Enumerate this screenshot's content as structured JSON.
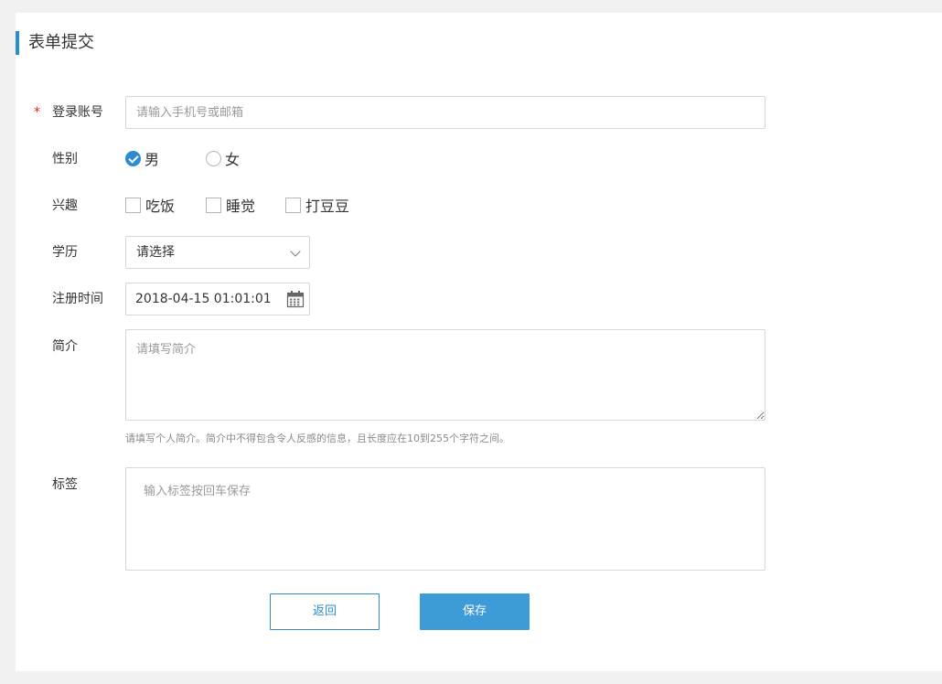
{
  "form": {
    "title": "表单提交",
    "required_mark": "*",
    "account": {
      "label": "登录账号",
      "value": "",
      "placeholder": "请输入手机号或邮箱"
    },
    "gender": {
      "label": "性别",
      "options": [
        {
          "label": "男",
          "checked": true
        },
        {
          "label": "女",
          "checked": false
        }
      ]
    },
    "interests": {
      "label": "兴趣",
      "options": [
        {
          "label": "吃饭",
          "checked": false
        },
        {
          "label": "睡觉",
          "checked": false
        },
        {
          "label": "打豆豆",
          "checked": false
        }
      ]
    },
    "education": {
      "label": "学历",
      "value": "请选择"
    },
    "register_time": {
      "label": "注册时间",
      "value": "2018-04-15 01:01:01"
    },
    "intro": {
      "label": "简介",
      "placeholder": "请填写简介",
      "hint": "请填写个人简介。简介中不得包含令人反感的信息，且长度应在10到255个字符之间。"
    },
    "tags": {
      "label": "标签",
      "placeholder": "输入标签按回车保存"
    },
    "buttons": {
      "back": "返回",
      "save": "保存"
    }
  },
  "colors": {
    "accent": "#2d8ccc",
    "primary_button": "#3d9bd8",
    "required": "#e0201a"
  },
  "icons": {
    "select": "chevron-down-icon",
    "date": "calendar-icon",
    "radio_checked": "checkmark-icon"
  }
}
